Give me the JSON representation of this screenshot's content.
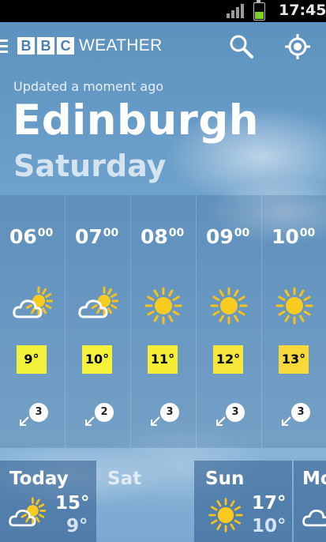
{
  "status_bar": {
    "time": "17:45"
  },
  "header": {
    "logo_letters": [
      "B",
      "B",
      "C"
    ],
    "brand": "WEATHER"
  },
  "location": {
    "updated": "Updated a moment ago",
    "city": "Edinburgh",
    "day": "Saturday"
  },
  "hourly": [
    {
      "hour": "06",
      "minutes": "00",
      "icon": "sun-cloud-icon",
      "temp": "9°",
      "temp_color": "#f2f23a",
      "wind_speed": "3"
    },
    {
      "hour": "07",
      "minutes": "00",
      "icon": "sun-cloud-icon",
      "temp": "10°",
      "temp_color": "#f6f23a",
      "wind_speed": "2"
    },
    {
      "hour": "08",
      "minutes": "00",
      "icon": "sun-icon",
      "temp": "11°",
      "temp_color": "#f6ee34",
      "wind_speed": "3"
    },
    {
      "hour": "09",
      "minutes": "00",
      "icon": "sun-icon",
      "temp": "12°",
      "temp_color": "#f7e73a",
      "wind_speed": "3"
    },
    {
      "hour": "10",
      "minutes": "00",
      "icon": "sun-icon",
      "temp": "13°",
      "temp_color": "#f8d93a",
      "wind_speed": "3"
    }
  ],
  "daily": [
    {
      "name": "Today",
      "icon": "sun-cloud-icon",
      "high": "15°",
      "low": "9°"
    },
    {
      "name": "Sat"
    },
    {
      "name": "Sun",
      "icon": "sun-icon",
      "high": "17°",
      "low": "10°"
    },
    {
      "name": "Mo",
      "icon": "cloud-icon"
    }
  ]
}
